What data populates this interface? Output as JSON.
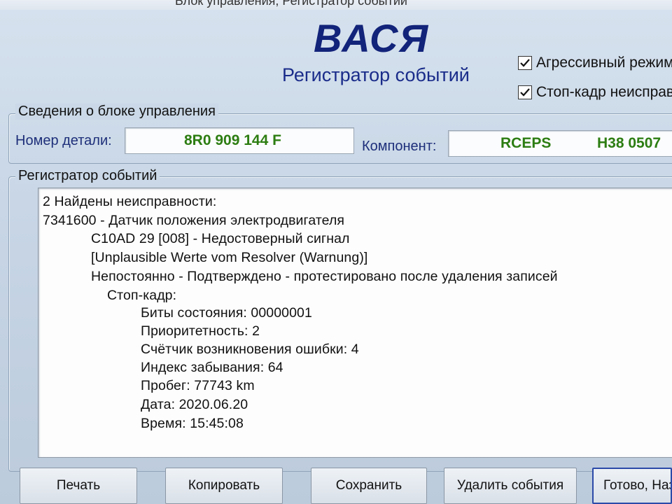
{
  "window": {
    "title": "Блок управления, Регистратор событий"
  },
  "header": {
    "logo": "ВАСЯ",
    "subtitle": "Регистратор событий"
  },
  "options": [
    {
      "label": "Агрессивный режим",
      "checked": true
    },
    {
      "label": "Стоп-кадр неисправ",
      "checked": true
    }
  ],
  "ecu_info": {
    "legend": "Сведения о блоке управления",
    "part_label": "Номер детали:",
    "part_value": "8R0 909 144 F",
    "component_label": "Компонент:",
    "component_name": "RCEPS",
    "component_version": "H38 0507"
  },
  "event_log": {
    "legend": "Регистратор событий",
    "lines": [
      "2 Найдены неисправности:",
      "7341600 - Датчик положения электродвигателя",
      "C10AD 29 [008] - Недостоверный сигнал",
      "[Unplausible Werte vom Resolver (Warnung)]",
      "Непостоянно - Подтверждено - протестировано после удаления записей",
      "Стоп-кадр:",
      "Биты состояния: 00000001",
      "Приоритетность: 2",
      "Счётчик возникновения ошибки: 4",
      "Индекс забывания: 64",
      "Пробег: 77743 km",
      "Дата: 2020.06.20",
      "Время: 15:45:08"
    ]
  },
  "buttons": {
    "print": "Печать",
    "copy": "Копировать",
    "save": "Сохранить",
    "delete_events": "Удалить события",
    "done": "Готово, Наз"
  }
}
